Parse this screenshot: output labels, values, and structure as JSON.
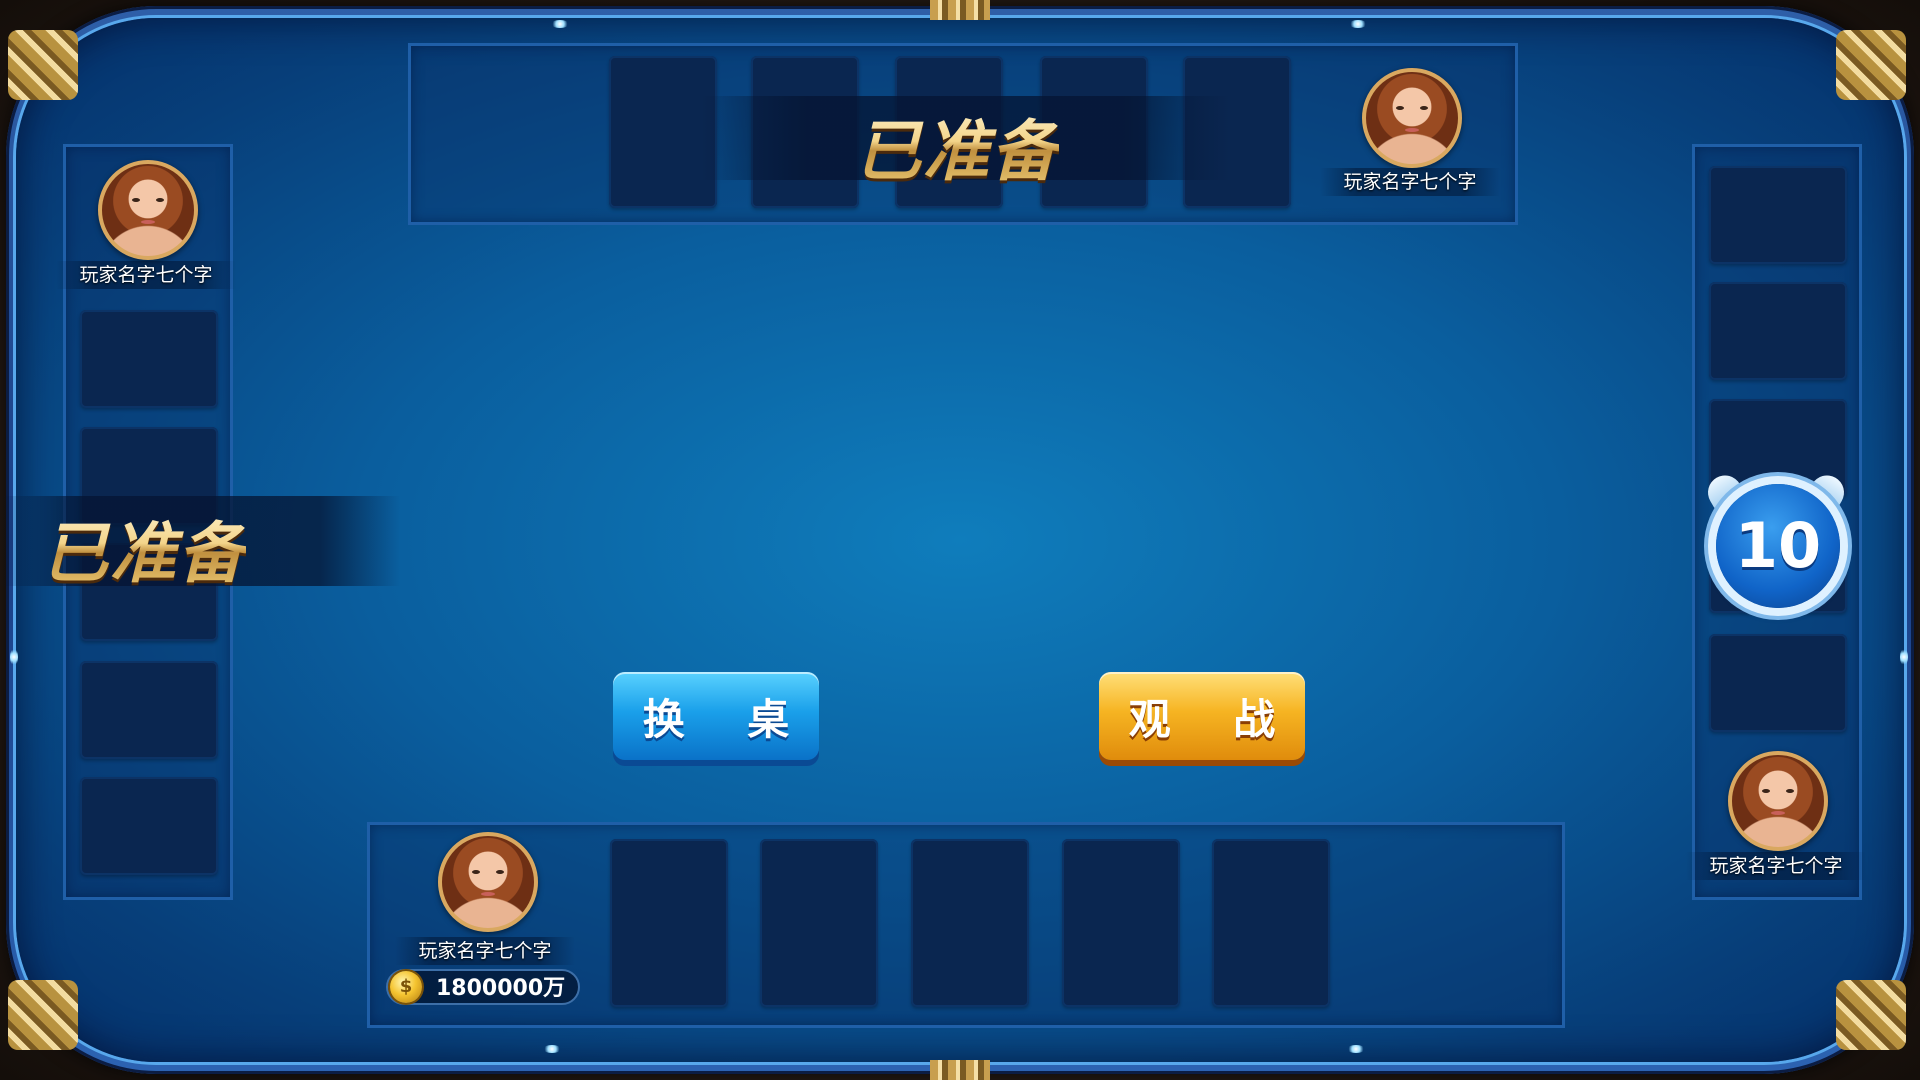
{
  "players": {
    "top": {
      "name": "玩家名字七个字",
      "status": "已准备"
    },
    "left": {
      "name": "玩家名字七个字",
      "status": "已准备"
    },
    "right": {
      "name": "玩家名字七个字",
      "timer": "10"
    },
    "self": {
      "name": "玩家名字七个字",
      "coins": "1800000万"
    }
  },
  "buttons": {
    "change_table": "换 桌",
    "spectate": "观 战"
  },
  "icons": {
    "coin": "coin-icon",
    "timer": "alarm-clock-icon"
  },
  "colors": {
    "felt": "#0a5e9e",
    "gold_text": "#f3d48a",
    "blue_button": "#1aa0ea",
    "gold_button": "#f6b422"
  }
}
